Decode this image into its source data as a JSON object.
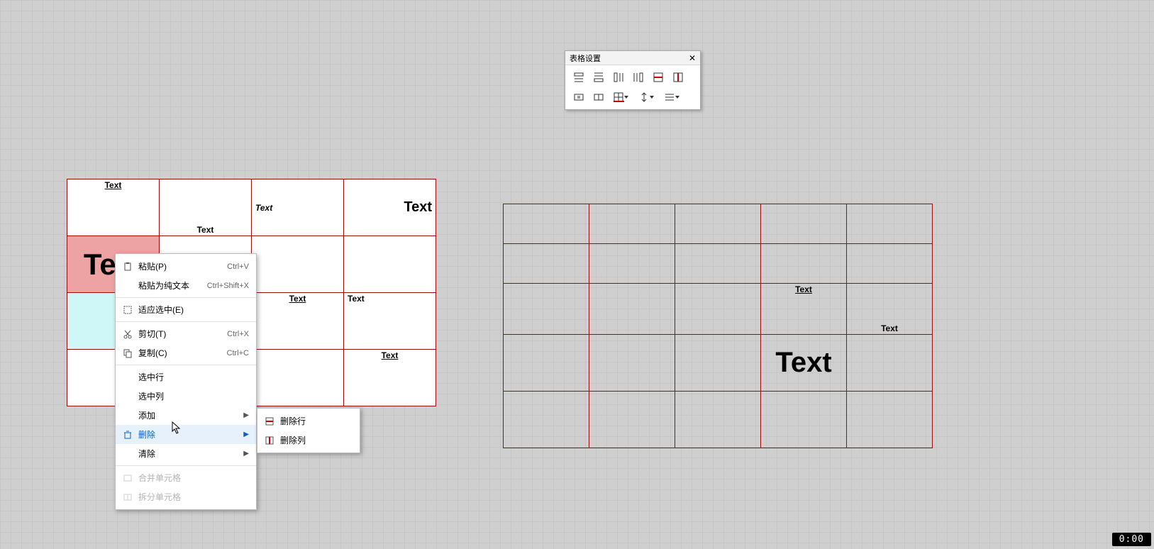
{
  "toolbar": {
    "title": "表格设置"
  },
  "tableA": {
    "r0c0": "Text",
    "r0c2": "Text",
    "r0c1": "Text",
    "r0c3": "Text",
    "r1c0": "Text",
    "r2c2": "Text",
    "r2c3": "Text",
    "r4c3": "Text"
  },
  "tableB": {
    "r2c3": "Text",
    "r2c4": "Text",
    "r3c3": "Text"
  },
  "ctx": {
    "paste": "粘贴(P)",
    "paste_sc": "Ctrl+V",
    "paste_plain": "粘贴为纯文本",
    "paste_plain_sc": "Ctrl+Shift+X",
    "fit_sel": "适应选中(E)",
    "cut": "剪切(T)",
    "cut_sc": "Ctrl+X",
    "copy": "复制(C)",
    "copy_sc": "Ctrl+C",
    "select_row": "选中行",
    "select_col": "选中列",
    "add": "添加",
    "delete": "删除",
    "clear": "清除",
    "merge": "合并单元格",
    "split": "拆分单元格"
  },
  "sub": {
    "del_row": "删除行",
    "del_col": "删除列"
  },
  "timer": "0:00"
}
